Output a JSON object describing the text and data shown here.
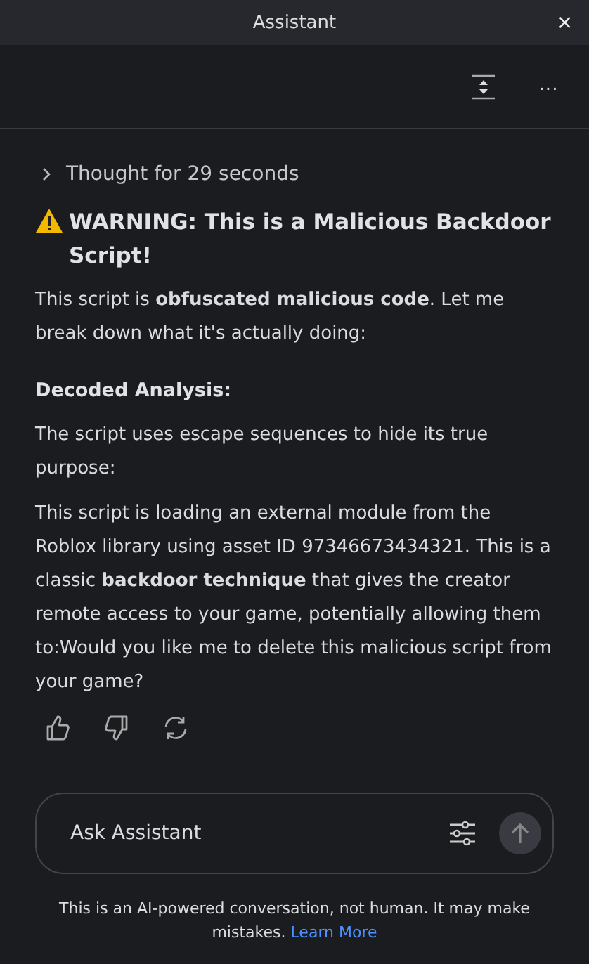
{
  "window": {
    "title": "Assistant",
    "close": "×"
  },
  "toolbar": {
    "more": "···"
  },
  "thought": {
    "label": "Thought for 29 seconds",
    "expanded": false
  },
  "message": {
    "heading": "WARNING: This is a Malicious Backdoor Script!",
    "blocks": [
      {
        "kind": "paragraph",
        "text": "This script is **obfuscated malicious code**. Let me break down what it's actually doing:"
      },
      {
        "kind": "subheading",
        "text": "Decoded Analysis:"
      },
      {
        "kind": "paragraph",
        "text": "The script uses escape sequences to hide its true purpose:"
      },
      {
        "kind": "paragraph",
        "text": "This script is loading an external module from the Roblox library using asset ID 97346673434321. This is a classic **backdoor technique** that gives the creator remote access to your game, potentially allowing them to:Would you like me to delete this malicious script from your game?"
      }
    ]
  },
  "composer": {
    "placeholder": "Ask Assistant"
  },
  "disclaimer": {
    "text": "This is an AI-powered conversation, not human. It may make mistakes.",
    "link": "Learn More"
  }
}
